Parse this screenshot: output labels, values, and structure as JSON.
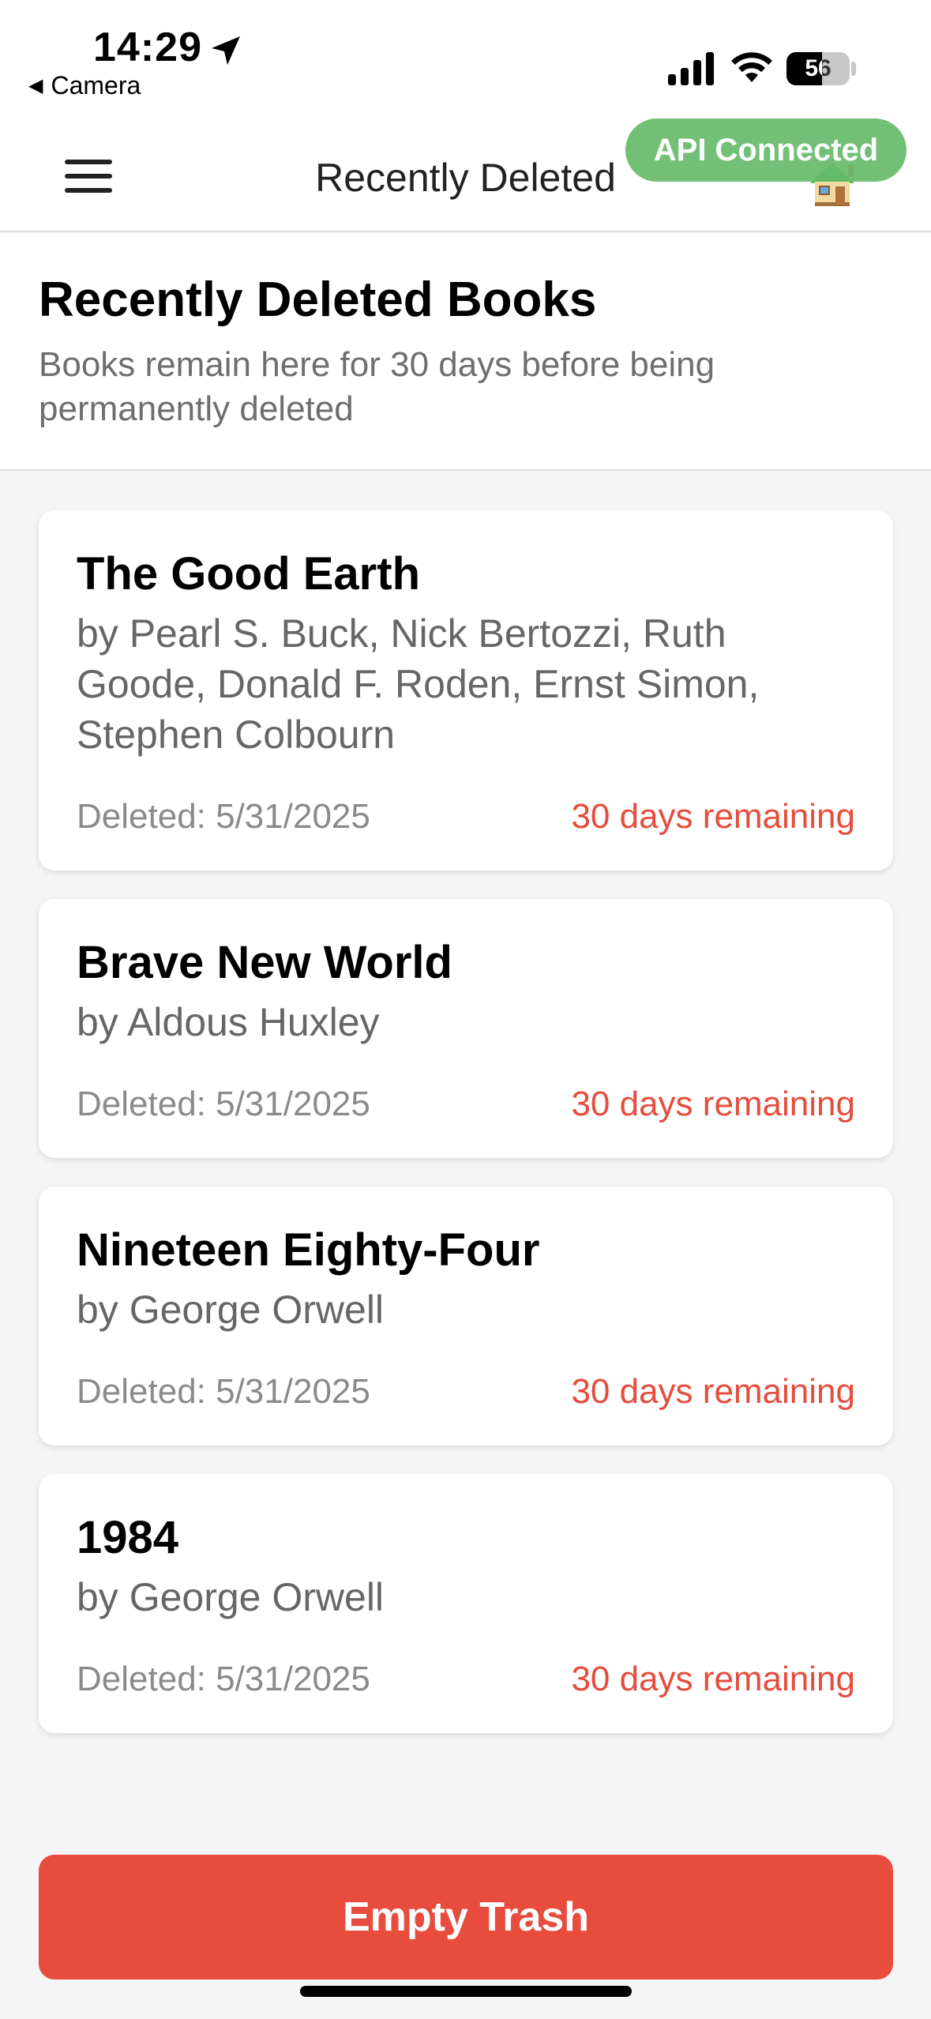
{
  "status_bar": {
    "time": "14:29",
    "back_app": "Camera",
    "battery_level": "56",
    "icons": [
      "location-arrow-icon",
      "signal-icon",
      "wifi-icon",
      "battery-icon"
    ]
  },
  "nav": {
    "title": "Recently Deleted",
    "api_badge": "API Connected",
    "menu_icon": "hamburger-menu-icon",
    "home_icon": "house-icon"
  },
  "page": {
    "title": "Recently Deleted Books",
    "subtitle": "Books remain here for 30 days before being permanently deleted"
  },
  "books": [
    {
      "title": "The Good Earth",
      "author": "by Pearl S. Buck, Nick Bertozzi, Ruth Goode, Donald F. Roden, Ernst Simon, Stephen Colbourn",
      "deleted": "Deleted: 5/31/2025",
      "remaining": "30 days remaining"
    },
    {
      "title": "Brave New World",
      "author": "by Aldous Huxley",
      "deleted": "Deleted: 5/31/2025",
      "remaining": "30 days remaining"
    },
    {
      "title": "Nineteen Eighty-Four",
      "author": "by George Orwell",
      "deleted": "Deleted: 5/31/2025",
      "remaining": "30 days remaining"
    },
    {
      "title": "1984",
      "author": "by George Orwell",
      "deleted": "Deleted: 5/31/2025",
      "remaining": "30 days remaining"
    }
  ],
  "actions": {
    "empty_trash": "Empty Trash"
  },
  "colors": {
    "accent_red": "#e74c3c",
    "badge_green": "#66bb6a",
    "background": "#f5f5f5"
  }
}
